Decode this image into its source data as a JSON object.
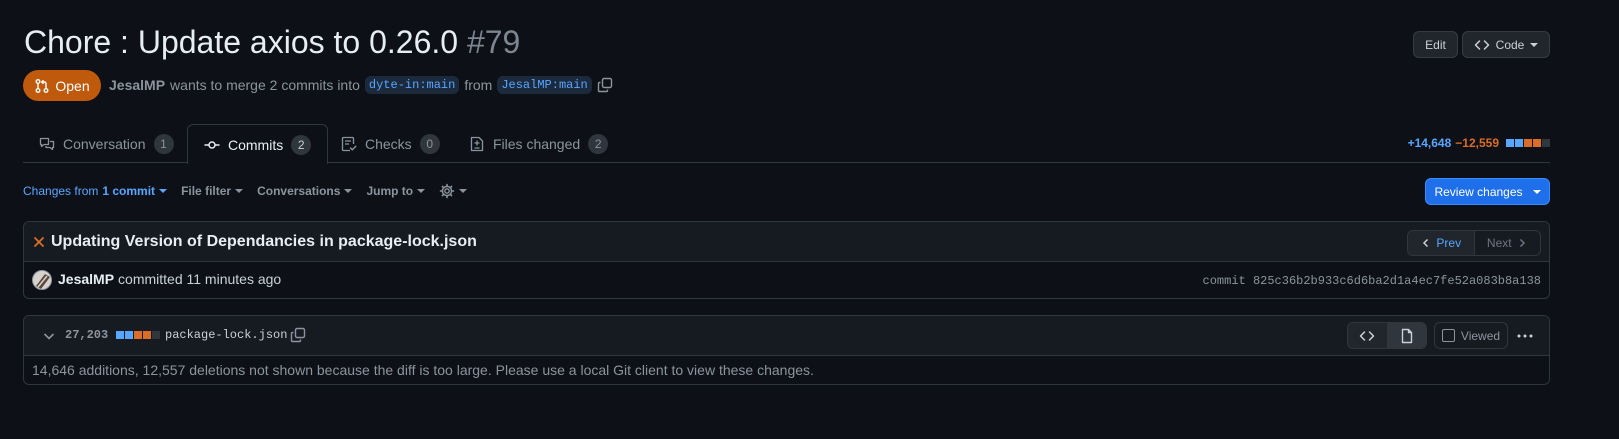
{
  "pr": {
    "title": "Chore : Update axios to 0.26.0",
    "number": "#79",
    "state": "Open",
    "author": "JesalMP",
    "merge_text": "wants to merge 2 commits into",
    "base_branch": "dyte-in:main",
    "from_text": "from",
    "head_branch": "JesalMP:main"
  },
  "header_actions": {
    "edit": "Edit",
    "code": "Code"
  },
  "tabs": [
    {
      "label": "Conversation",
      "count": "1"
    },
    {
      "label": "Commits",
      "count": "2"
    },
    {
      "label": "Checks",
      "count": "0"
    },
    {
      "label": "Files changed",
      "count": "2"
    }
  ],
  "diffstat": {
    "additions": "+14,648",
    "deletions": "−12,559",
    "blocks": [
      "added",
      "added",
      "deleted",
      "deleted",
      "neutral"
    ]
  },
  "toolbar": {
    "changes_from": "Changes from",
    "changes_commit": "1 commit",
    "file_filter": "File filter",
    "conversations": "Conversations",
    "jump_to": "Jump to",
    "review_changes": "Review changes"
  },
  "commit": {
    "title": "Updating Version of Dependancies in package-lock.json",
    "prev": "Prev",
    "next": "Next",
    "author": "JesalMP",
    "committed_text": "committed 11 minutes ago",
    "sha": "commit 825c36b2b933c6d6ba2d1a4ec7fe52a083b8a138"
  },
  "file": {
    "changes": "27,203",
    "blocks": [
      "added",
      "added",
      "deleted",
      "deleted",
      "neutral"
    ],
    "name": "package-lock.json",
    "viewed": "Viewed",
    "notice": "14,646 additions, 12,557 deletions not shown because the diff is too large. Please use a local Git client to view these changes."
  },
  "colors": {
    "background": "#0d1117",
    "added": "#58a6ff",
    "deleted": "#db6d28",
    "neutral": "#30363d",
    "open_state": "#bf5a0c",
    "primary_button": "#1f6feb",
    "commit_status_fail": "#db6d28"
  },
  "icons": {
    "state": "git-pull-request-icon",
    "copy": "copy-icon",
    "conversation": "comment-discussion-icon",
    "commits": "git-commit-icon",
    "checks": "checklist-icon",
    "files": "file-diff-icon",
    "settings": "gear-icon",
    "status": "x-icon",
    "collapse": "chevron-down-icon",
    "source_view": "code-icon",
    "rich_view": "file-icon",
    "more": "kebab-horizontal-icon"
  }
}
